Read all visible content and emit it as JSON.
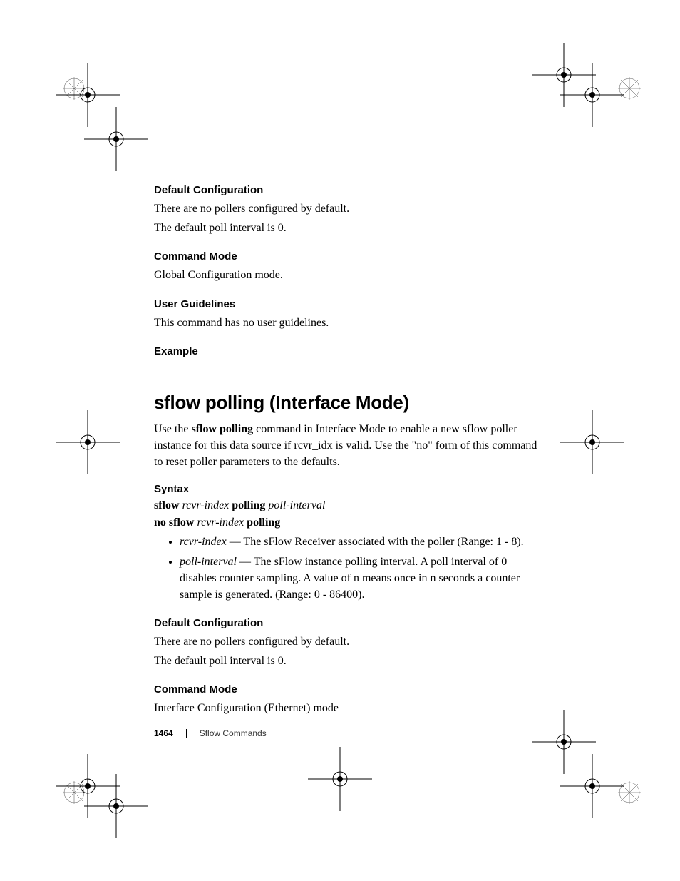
{
  "section1": {
    "defaultConfig": {
      "heading": "Default Configuration",
      "line1": "There are no pollers configured by default.",
      "line2": "The default poll interval is 0."
    },
    "commandMode": {
      "heading": "Command Mode",
      "body": "Global Configuration mode."
    },
    "guidelines": {
      "heading": "User Guidelines",
      "body": "This command has no user guidelines."
    },
    "example": {
      "heading": "Example"
    }
  },
  "section2": {
    "title": "sflow polling (Interface Mode)",
    "intro_part1": "Use the ",
    "intro_bold": "sflow polling",
    "intro_part2": " command in Interface Mode to enable a new sflow poller instance for this data source if rcvr_idx is valid.  Use the \"no\" form of this command to reset poller parameters to the defaults.",
    "syntax": {
      "heading": "Syntax",
      "line1": {
        "w1": "sflow ",
        "w2": "rcvr-index",
        "w3": " polling ",
        "w4": "poll-interval"
      },
      "line2": {
        "w1": "no sflow ",
        "w2": "rcvr-index",
        "w3": " polling"
      },
      "bullets": [
        {
          "term": "rcvr-index",
          "desc": " — The sFlow Receiver associated with the poller (Range: 1 - 8)."
        },
        {
          "term": "poll-interval",
          "desc": " — The sFlow instance polling interval.  A poll interval of 0 disables counter sampling.  A value of n means once in n seconds a counter sample is generated.  (Range: 0 - 86400)."
        }
      ]
    },
    "defaultConfig": {
      "heading": "Default Configuration",
      "line1": "There are no pollers configured by default.",
      "line2": "The default poll interval is 0."
    },
    "commandMode": {
      "heading": "Command Mode",
      "body": "Interface Configuration (Ethernet) mode"
    }
  },
  "footer": {
    "page": "1464",
    "chapter": "Sflow Commands"
  }
}
